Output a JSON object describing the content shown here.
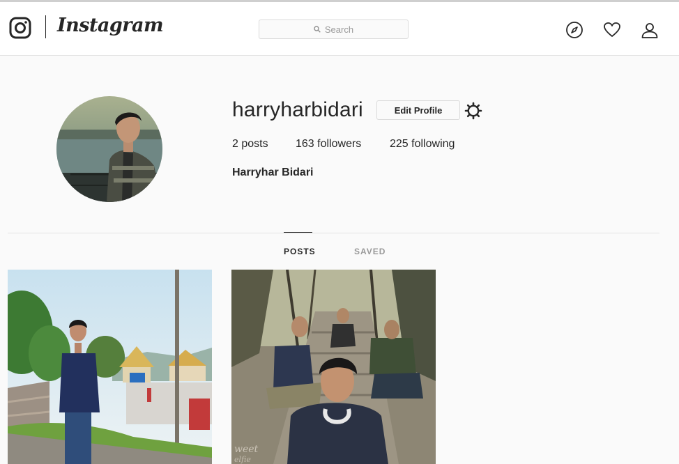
{
  "header": {
    "brand": "Instagram",
    "search": {
      "placeholder": "Search"
    },
    "icons": [
      "instagram-camera-icon",
      "compass-icon",
      "heart-icon",
      "user-icon"
    ]
  },
  "profile": {
    "username": "harryharbidari",
    "edit_button": "Edit Profile",
    "settings_icon": "gear-icon",
    "stats": {
      "posts_count": "2",
      "posts_label": "posts",
      "followers_count": "163",
      "followers_label": "followers",
      "following_count": "225",
      "following_label": "following"
    },
    "full_name": "Harryhar Bidari"
  },
  "tabs": [
    {
      "label": "POSTS",
      "active": true
    },
    {
      "label": "SAVED",
      "active": false
    }
  ],
  "posts": [
    {
      "description": "photo"
    },
    {
      "description": "photo"
    }
  ],
  "colors": {
    "text": "#262626",
    "muted": "#999999",
    "border": "#dbdbdb",
    "background": "#fafafa"
  }
}
